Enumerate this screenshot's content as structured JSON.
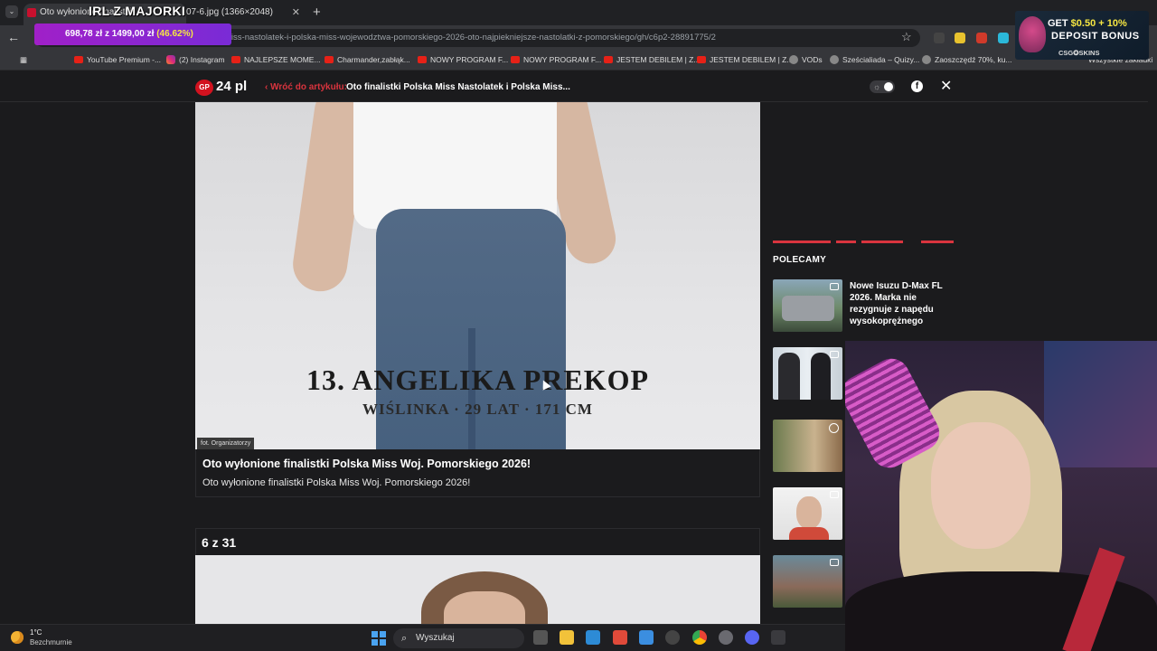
{
  "browser": {
    "tab1_title": "Oto wyłonione finalistki",
    "tab2_title": "07-6.jpg (1366×2048)",
    "url": "miss-nastolatek-i-polska-miss-wojewodztwa-pomorskiego-2026-oto-najpiekniejsze-nastolatki-z-pomorskiego/gh/c6p2-28891775/2",
    "bookmarks": [
      "YouTube Premium -...",
      "(2) Instagram",
      "NAJLEPSZE MOME...",
      "Charmander,zabłąk...",
      "NOWY PROGRAM F...",
      "NOWY PROGRAM F...",
      "JESTEM DEBILEM | Z...",
      "JESTEM DEBILEM | Z...",
      "VODs",
      "Sześcialiada – Quizy...",
      "Zaoszczędź 70%, ku...",
      "Wszystkie zakładki"
    ]
  },
  "stream_overlay": {
    "title": "IRL Z MAJORKI",
    "goal_current": "698,78 zł",
    "goal_sep": "z",
    "goal_target": "1499,00 zł",
    "goal_percent": "(46.62%)",
    "goal_progress": 0.4662
  },
  "ad": {
    "line1_a": "GET ",
    "line1_b": "$0.50 + 10%",
    "line2": "DEPOSIT BONUS",
    "brand": "CSG✪SKINS"
  },
  "site": {
    "logo_gp": "GP",
    "logo_text": "24 pl",
    "back_link": "‹ Wróć do artykułu:",
    "article_title": "Oto finalistki Polska Miss Nastolatek i Polska Miss..."
  },
  "gallery": {
    "photo_name": "13. ANGELIKA PREKOP",
    "photo_sub": "WIŚLINKA · 29 LAT · 171 CM",
    "photo_credit": "fot. Organizatorzy",
    "caption_title": "Oto wyłonione finalistki Polska Miss Woj. Pomorskiego 2026!",
    "caption_desc": "Oto wyłonione finalistki Polska Miss Woj. Pomorskiego 2026!",
    "counter": "6 z 31"
  },
  "sidebar": {
    "heading": "POLECAMY",
    "items": [
      {
        "title": "Nowe Isuzu D-Max FL 2026. Marka nie rezygnuje z napędu wysokoprężnego"
      }
    ]
  },
  "taskbar": {
    "temperature": "1°C",
    "weather": "Bezchmurnie",
    "search_placeholder": "Wyszukaj"
  },
  "colors": {
    "accent_red": "#d9343e",
    "page_bg": "#1b1b1d",
    "overlay_purple": "#a020c8"
  }
}
